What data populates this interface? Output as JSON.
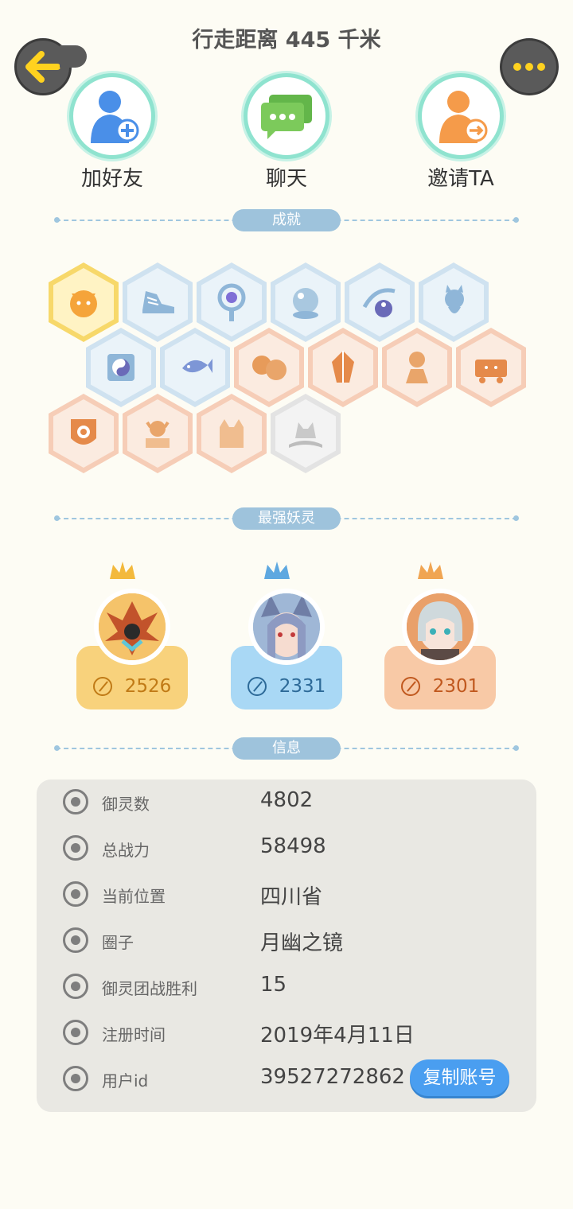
{
  "header": {
    "title": "行走距离 445 千米"
  },
  "actions": [
    {
      "label": "加好友",
      "icon": "add-friend-icon"
    },
    {
      "label": "聊天",
      "icon": "chat-icon"
    },
    {
      "label": "邀请TA",
      "icon": "invite-icon"
    }
  ],
  "sections": {
    "achievements": "成就",
    "strongest": "最强妖灵",
    "info": "信息"
  },
  "top_spirits": [
    {
      "power": "2526",
      "color": "#f8d27c",
      "text_color": "#c07a16",
      "crown": "gold"
    },
    {
      "power": "2331",
      "color": "#a9d8f5",
      "text_color": "#2d6a98",
      "crown": "blue"
    },
    {
      "power": "2301",
      "color": "#f8c9a6",
      "text_color": "#c0581e",
      "crown": "bronze"
    }
  ],
  "info": {
    "rows": [
      {
        "label": "御灵数",
        "value": "4802",
        "icon": "spirit-count-icon"
      },
      {
        "label": "总战力",
        "value": "58498",
        "icon": "sword-icon"
      },
      {
        "label": "当前位置",
        "value": "四川省",
        "icon": "location-icon"
      },
      {
        "label": "圈子",
        "value": "月幽之镜",
        "icon": "circle-icon"
      },
      {
        "label": "御灵团战胜利",
        "value": "15",
        "icon": "trophy-icon"
      },
      {
        "label": "注册时间",
        "value": "2019年4月11日",
        "icon": "clock-icon"
      },
      {
        "label": "用户id",
        "value": "39527272862",
        "icon": "id-card-icon"
      }
    ],
    "copy_label": "复制账号"
  },
  "colors": {
    "accent": "#4a9ef0",
    "pill": "#9ec3dc",
    "gold": "#ffd21f"
  }
}
